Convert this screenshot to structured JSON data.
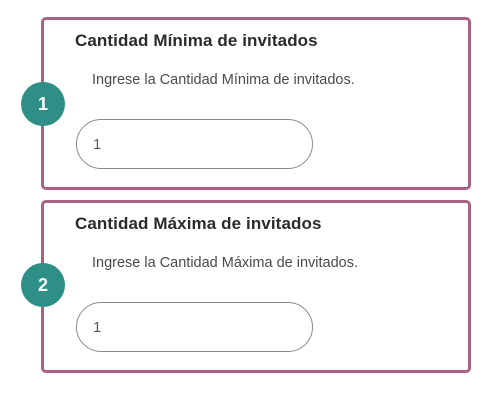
{
  "fields": {
    "min": {
      "label": "Cantidad Mínima de invitados",
      "help": "Ingrese la Cantidad Mínima de invitados.",
      "value": "1"
    },
    "max": {
      "label": "Cantidad Máxima de invitados",
      "help": "Ingrese la Cantidad Máxima de invitados.",
      "value": "1"
    }
  },
  "badges": {
    "step1": "1",
    "step2": "2"
  },
  "colors": {
    "card_border": "#a86283",
    "badge_bg": "#2e8f86",
    "badge_text": "#ffffff"
  }
}
